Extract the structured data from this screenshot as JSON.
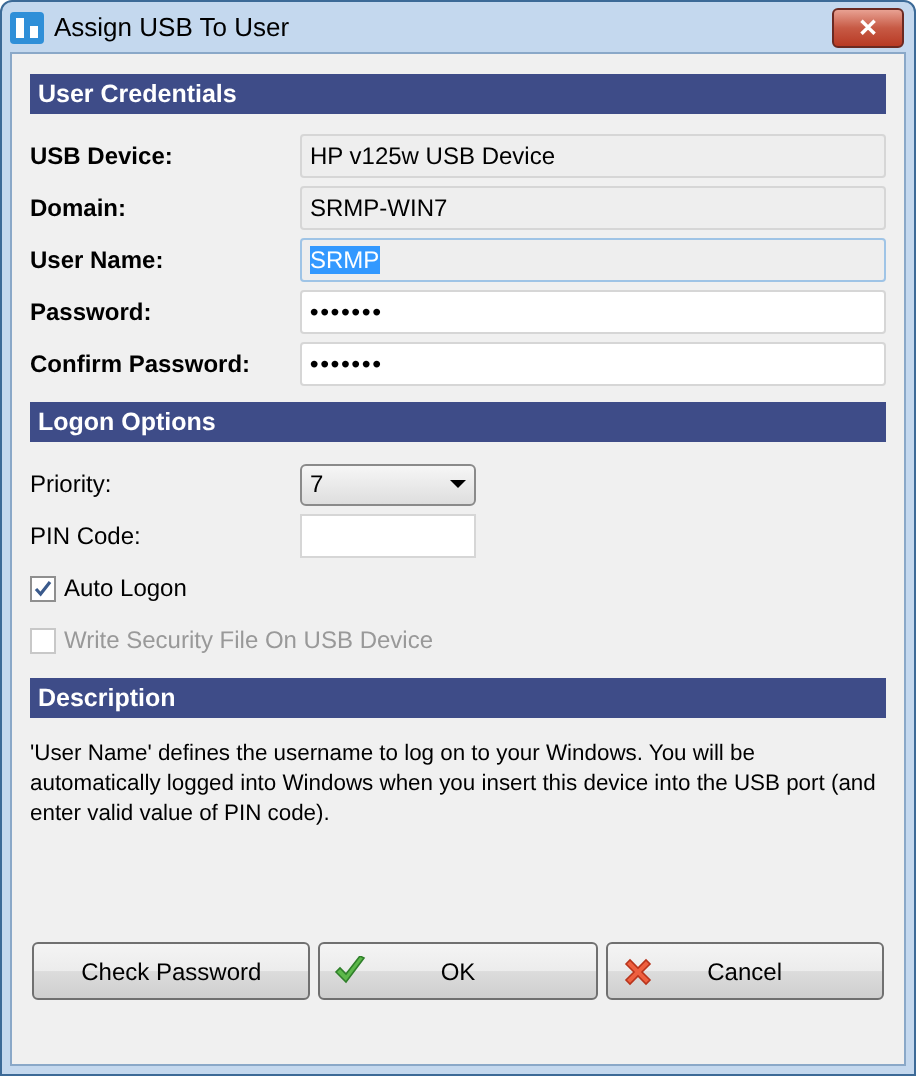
{
  "window": {
    "title": "Assign USB To User",
    "close": "✕"
  },
  "sections": [
    {
      "kind": "credentials",
      "title": "User Credentials",
      "rows": [
        {
          "kind": "field",
          "label": "USB Device:",
          "value": "HP v125w USB Device",
          "readonly": true,
          "focused": false
        },
        {
          "kind": "field",
          "label": "Domain:",
          "value": "SRMP-WIN7",
          "readonly": true,
          "focused": false
        },
        {
          "kind": "field",
          "label": "User Name:",
          "value": "SRMP",
          "readonly": true,
          "focused": true
        },
        {
          "kind": "field",
          "label": "Password:",
          "value": "•••••••",
          "readonly": false,
          "focused": false
        },
        {
          "kind": "field",
          "label": "Confirm Password:",
          "value": "•••••••",
          "readonly": false,
          "focused": false
        }
      ]
    },
    {
      "kind": "options",
      "title": "Logon Options",
      "rows": [
        {
          "kind": "combo",
          "label": "Priority:",
          "value": "7"
        },
        {
          "kind": "short-field",
          "label": "PIN Code:"
        },
        {
          "kind": "checkbox",
          "label": "Auto Logon",
          "checked": true,
          "disabled": false
        },
        {
          "kind": "checkbox",
          "label": "Write Security File On USB Device",
          "checked": false,
          "disabled": true
        }
      ]
    },
    {
      "kind": "description",
      "title": "Description",
      "text": "'User Name' defines the username to log on to your Windows. You will be automatically logged into Windows when you insert this device into the USB port (and enter valid value of PIN code)."
    }
  ],
  "buttons": [
    {
      "label": "Check Password",
      "kind": "plain"
    },
    {
      "label": "OK",
      "kind": "confirm"
    },
    {
      "label": "Cancel",
      "kind": "cancel"
    }
  ]
}
